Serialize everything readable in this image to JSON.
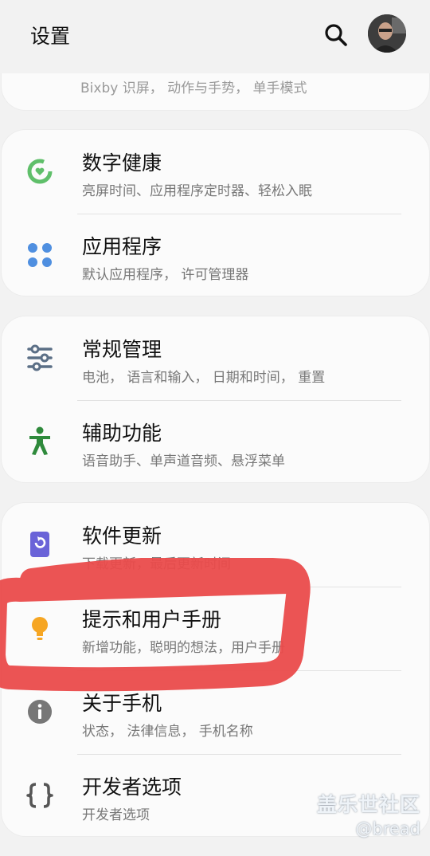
{
  "header": {
    "title": "设置"
  },
  "top_partial": {
    "subtitle": "Bixby 识屏， 动作与手势， 单手模式"
  },
  "rows": [
    {
      "title": "数字健康",
      "subtitle": "亮屏时间、应用程序定时器、轻松入眠"
    },
    {
      "title": "应用程序",
      "subtitle": "默认应用程序， 许可管理器"
    },
    {
      "title": "常规管理",
      "subtitle": "电池， 语言和输入， 日期和时间， 重置"
    },
    {
      "title": "辅助功能",
      "subtitle": "语音助手、单声道音频、悬浮菜单"
    },
    {
      "title": "软件更新",
      "subtitle": "下载更新，最后更新时间"
    },
    {
      "title": "提示和用户手册",
      "subtitle": "新增功能，聪明的想法，用户手册"
    },
    {
      "title": "关于手机",
      "subtitle": "状态， 法律信息， 手机名称"
    },
    {
      "title": "开发者选项",
      "subtitle": "开发者选项"
    }
  ],
  "watermark": {
    "line1": "盖乐世社区",
    "line2": "@bread"
  },
  "colors": {
    "wellbeing": "#5fbf6a",
    "apps": "#4f8fe0",
    "accessibility": "#2f8a3c",
    "update": "#6a63d8",
    "tips": "#f6a623",
    "about": "#777777",
    "highlight_scribble": "#ea4b4b"
  }
}
